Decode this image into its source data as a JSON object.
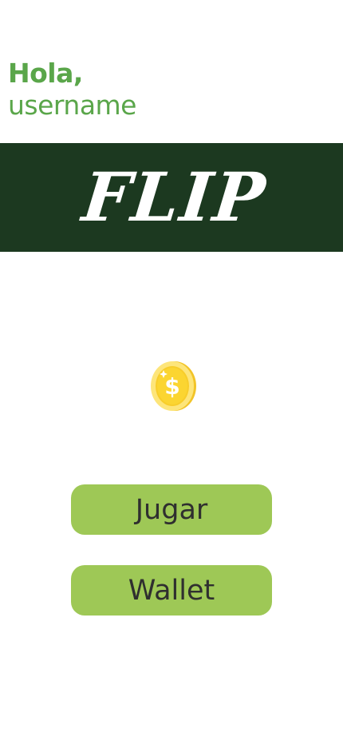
{
  "greeting": {
    "hello": "Hola,",
    "username": "username"
  },
  "banner": {
    "title": "FLIP",
    "background_color": "#1c3920"
  },
  "coin": {
    "icon": "coin-icon",
    "symbol": "$"
  },
  "buttons": {
    "play_label": "Jugar",
    "wallet_label": "Wallet",
    "color": "#9ec856"
  },
  "colors": {
    "accent_text": "#5aa64a",
    "banner": "#1c3920",
    "button": "#9ec856"
  }
}
